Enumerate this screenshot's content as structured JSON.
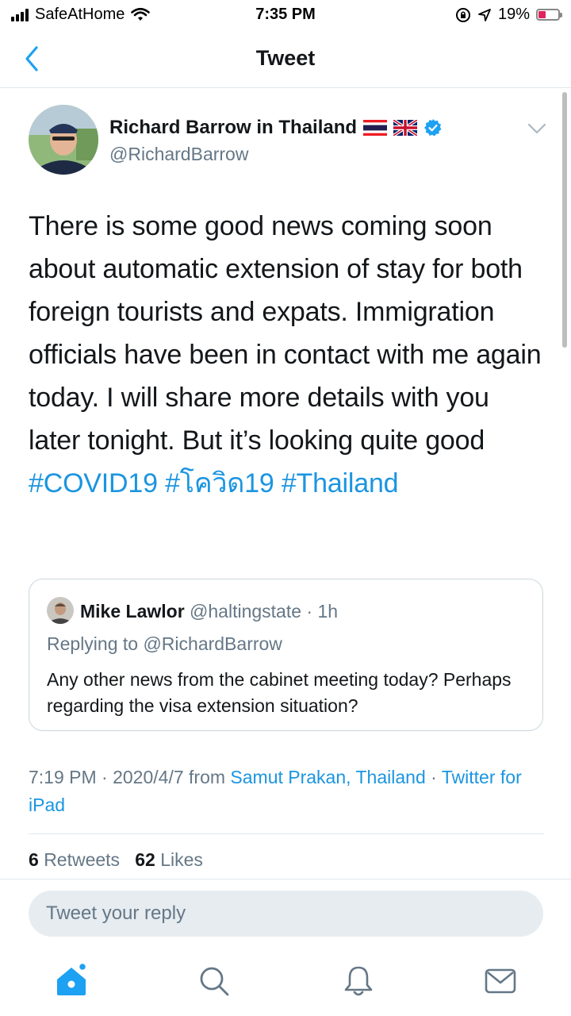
{
  "status_bar": {
    "carrier": "SafeAtHome",
    "time": "7:35 PM",
    "battery": "19%",
    "battery_level": 0.19
  },
  "nav": {
    "title": "Tweet"
  },
  "tweet": {
    "author_name": "Richard Barrow in Thailand",
    "handle": "@RichardBarrow",
    "text_plain": "There is some good news coming soon about automatic extension of stay for both foreign tourists and expats. Immigration officials have been in contact with me again today. I will share more details with you later tonight. But it’s looking quite good ",
    "hashtags": [
      "#COVID19",
      "#โควิด19",
      "#Thailand"
    ],
    "timestamp": "7:19 PM · 2020/4/7 from ",
    "location": "Samut Prakan, Thailand",
    "separator": " · ",
    "source": "Twitter for iPad",
    "retweets_count": "6",
    "retweets_label": "Retweets",
    "likes_count": "62",
    "likes_label": "Likes"
  },
  "quoted_tweet": {
    "name": "Mike Lawlor",
    "handle": "@haltingstate",
    "time": " · 1h",
    "replying_to": "Replying to @RichardBarrow",
    "text": "Any other news from the cabinet meeting today? Perhaps regarding the visa extension situation?"
  },
  "reply": {
    "placeholder": "Tweet your reply"
  },
  "colors": {
    "accent": "#1b95e0",
    "secondary_text": "#657786",
    "primary_text": "#14171a",
    "divider": "#e1e8ed"
  },
  "icons": [
    "back-chevron-icon",
    "verified-badge-icon",
    "thailand-flag-icon",
    "uk-flag-icon",
    "chevron-down-icon",
    "home-icon",
    "search-icon",
    "notifications-icon",
    "messages-icon"
  ]
}
